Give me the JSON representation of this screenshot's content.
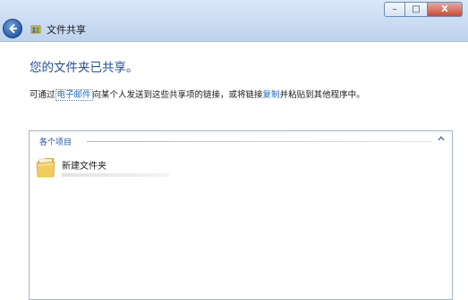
{
  "window": {
    "title": "文件共享",
    "controls": {
      "minimize": "–",
      "maximize": "□",
      "close": "X"
    }
  },
  "main": {
    "heading": "您的文件夹已共享。",
    "description": {
      "part1": "可通过",
      "email_link": "电子邮件",
      "part2": "向某个人发送到这些共享项的链接，或将链接",
      "copy_link": "复制",
      "part3": "并粘贴到其他程序中。"
    },
    "items": {
      "group_label": "各个项目",
      "list": [
        {
          "name": "新建文件夹",
          "icon": "folder-icon"
        }
      ]
    }
  },
  "colors": {
    "heading": "#1e4f9a",
    "link": "#1a6ac8",
    "titlebar": "#c9dcf2"
  }
}
